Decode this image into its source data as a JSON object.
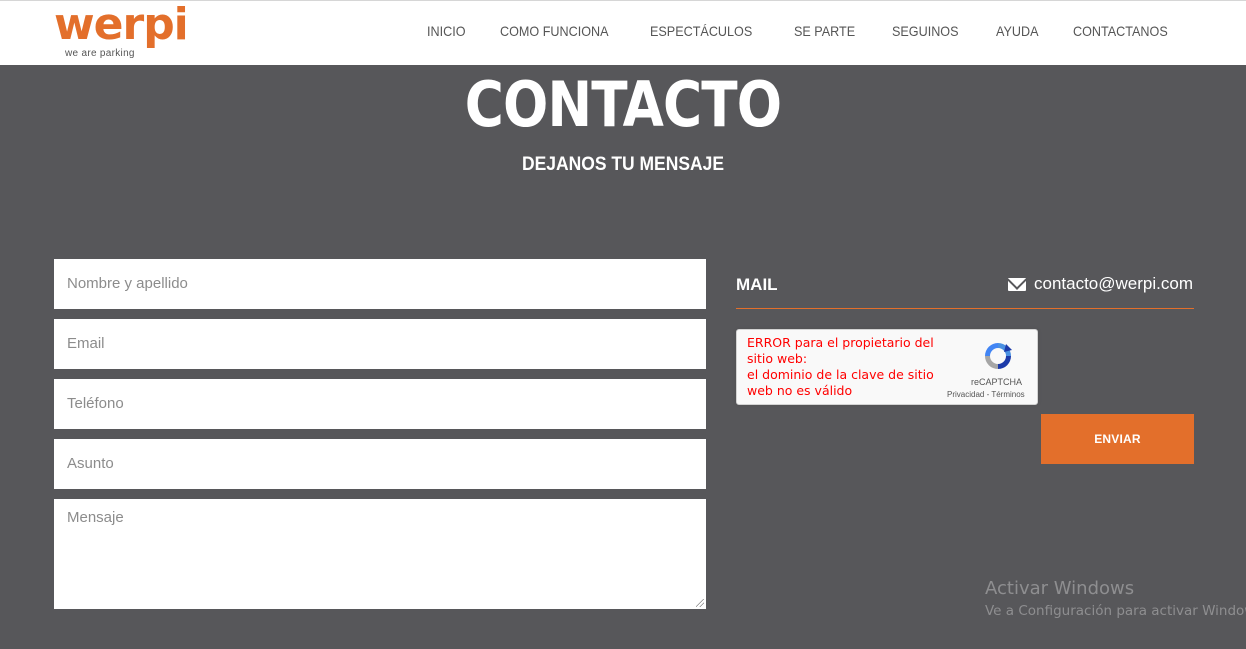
{
  "header": {
    "logo": {
      "word": "werpi",
      "tagline": "we are parking"
    },
    "nav": [
      "INICIO",
      "COMO FUNCIONA",
      "ESPECTÁCULOS",
      "SE PARTE",
      "SEGUINOS",
      "AYUDA",
      "CONTACTANOS"
    ]
  },
  "hero": {
    "title": "CONTACTO",
    "subtitle": "DEJANOS TU MENSAJE"
  },
  "form": {
    "name_placeholder": "Nombre y apellido",
    "email_placeholder": "Email",
    "phone_placeholder": "Teléfono",
    "subject_placeholder": "Asunto",
    "message_placeholder": "Mensaje",
    "submit_label": "ENVIAR"
  },
  "contact": {
    "mail_label": "MAIL",
    "mail_icon": "envelope-icon",
    "mail_value": "contacto@werpi.com"
  },
  "recaptcha": {
    "error_text": "ERROR para el propietario del sitio web:\nel dominio de la clave de sitio web no es válido",
    "name": "reCAPTCHA",
    "privacy": "Privacidad",
    "separator": " - ",
    "terms": "Términos"
  },
  "watermark": {
    "title": "Activar Windows",
    "subtitle": "Ve a Configuración para activar Windows."
  },
  "colors": {
    "accent": "#e36f2b",
    "background": "#57575a",
    "error": "#ff0000"
  }
}
